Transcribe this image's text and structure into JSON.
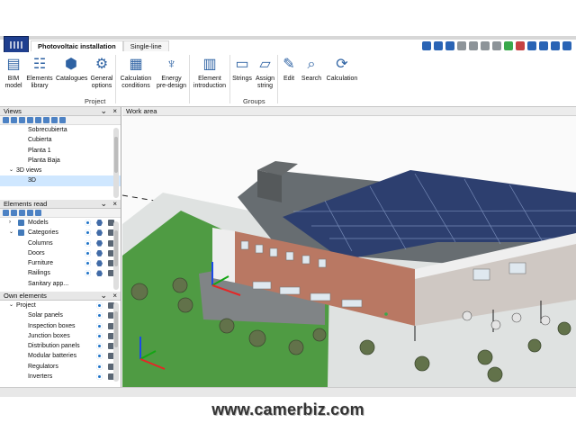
{
  "tabs": [
    {
      "label": "Photovoltaic installation"
    },
    {
      "label": "Single-line"
    }
  ],
  "ribbon": {
    "buttons": [
      {
        "label": "BIM\nmodel",
        "icon": "bim-model-icon"
      },
      {
        "label": "Elements\nlibrary",
        "icon": "elements-library-icon"
      },
      {
        "label": "Catalogues",
        "icon": "catalogues-icon"
      },
      {
        "label": "General\noptions",
        "icon": "general-options-icon"
      },
      {
        "label": "Calculation\nconditions",
        "icon": "calculation-conditions-icon"
      },
      {
        "label": "Energy\npre-design",
        "icon": "energy-predesign-icon"
      },
      {
        "label": "Element\nintroduction",
        "icon": "element-introduction-icon"
      },
      {
        "label": "Strings",
        "icon": "strings-icon"
      },
      {
        "label": "Assign\nstring",
        "icon": "assign-string-icon"
      },
      {
        "label": "Edit",
        "icon": "edit-icon"
      },
      {
        "label": "Search",
        "icon": "search-icon"
      },
      {
        "label": "Calculation",
        "icon": "calculation-icon"
      }
    ],
    "groups": {
      "project": "Project",
      "groups": "Groups"
    }
  },
  "views": {
    "title": "Views",
    "items": [
      "Sobrecubierta",
      "Cubierta",
      "Planta 1",
      "Planta Baja",
      "3D views",
      "3D"
    ]
  },
  "elements_read": {
    "title": "Elements read",
    "items": [
      "Models",
      "Categories",
      "Columns",
      "Doors",
      "Furniture",
      "Railings",
      "Sanitary app..."
    ]
  },
  "own_elements": {
    "title": "Own elements",
    "items": [
      "Project",
      "Solar panels",
      "Inspection boxes",
      "Junction boxes",
      "Distribution panels",
      "Modular batteries",
      "Regulators",
      "Inverters"
    ]
  },
  "workarea": {
    "title": "Work area"
  },
  "watermark": "www.camerbiz.com",
  "colors": {
    "ribbon_accent": "#2e62a3",
    "selection": "#cfe7ff",
    "roof": "#6c7478",
    "brick": "#b97863",
    "grass": "#4f9b43"
  }
}
